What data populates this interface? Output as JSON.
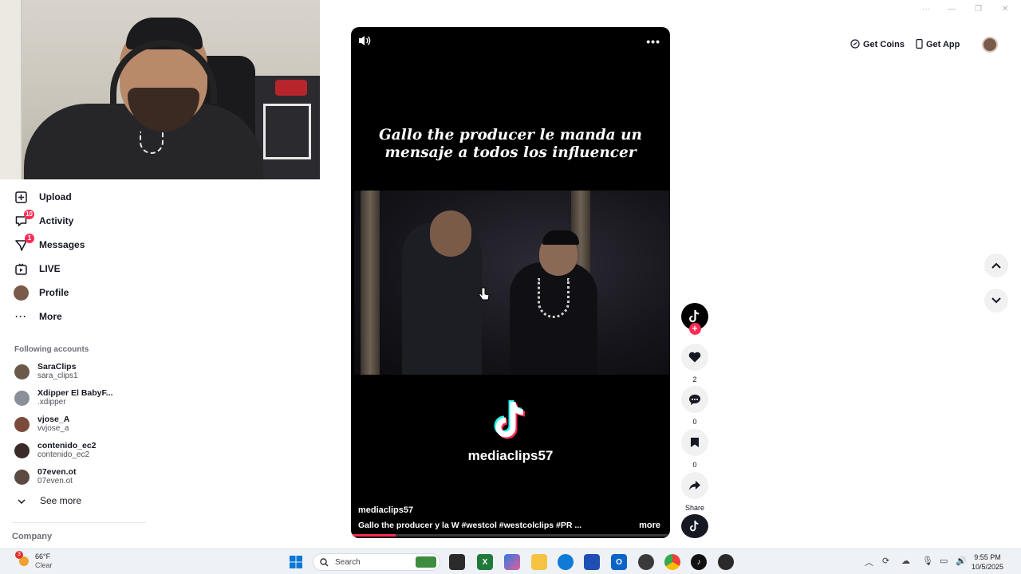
{
  "nav": {
    "items": [
      {
        "label": "Upload",
        "icon": "upload-icon",
        "badge": ""
      },
      {
        "label": "Activity",
        "icon": "activity-icon",
        "badge": "10"
      },
      {
        "label": "Messages",
        "icon": "messages-icon",
        "badge": "1"
      },
      {
        "label": "LIVE",
        "icon": "live-icon",
        "badge": ""
      },
      {
        "label": "Profile",
        "icon": "profile-avatar",
        "badge": ""
      },
      {
        "label": "More",
        "icon": "more-icon",
        "badge": ""
      }
    ]
  },
  "following": {
    "title": "Following accounts",
    "accounts": [
      {
        "name": "SaraClips",
        "handle": "sara_clips1",
        "color": "#6b5a4a"
      },
      {
        "name": "Xdipper El BabyF...",
        "handle": ".xdipper",
        "color": "#8a8f9a"
      },
      {
        "name": "vjose_A",
        "handle": "vvjose_a",
        "color": "#7a4a3a"
      },
      {
        "name": "contenido_ec2",
        "handle": "contenido_ec2",
        "color": "#3a2a2a"
      },
      {
        "name": "07even.ot",
        "handle": "07even.ot",
        "color": "#5a4a42"
      }
    ],
    "see_more": "See more"
  },
  "footer": {
    "company": "Company"
  },
  "video": {
    "title_line1": "Gallo the producer le manda un",
    "title_line2": "mensaje a todos los influencer",
    "brand": "mediaclips57",
    "username": "mediaclips57",
    "caption": "Gallo the producer y la W #westcol  #westcolclips  #PR  ...",
    "more": "more",
    "progress": 0.14,
    "menu": "•••"
  },
  "actions": {
    "likes": "2",
    "comments": "0",
    "saves": "0",
    "share_label": "Share"
  },
  "topbar": {
    "get_coins": "Get Coins",
    "get_app": "Get App"
  },
  "window_controls": [
    "···",
    "—",
    "❐",
    "✕"
  ],
  "taskbar": {
    "temp": "66°F",
    "condition": "Clear",
    "weather_badge": "3",
    "search_placeholder": "Search",
    "time": "9:55 PM",
    "date": "10/5/2025"
  },
  "colors": {
    "accent": "#fe2c55",
    "text": "#161823",
    "cyan": "#25f4ee"
  }
}
